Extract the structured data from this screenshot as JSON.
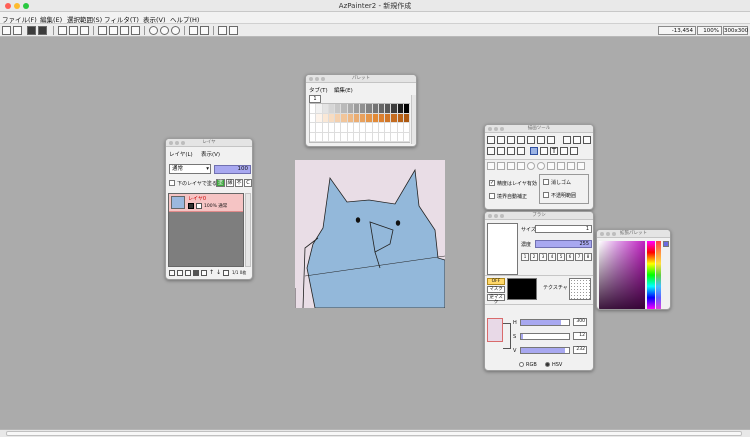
{
  "window": {
    "title": "AzPainter2 - 新規作成"
  },
  "menu": [
    "ファイル(F)",
    "編集(E)",
    "選択範囲(S)",
    "フィルタ(T)",
    "表示(V)",
    "ヘルプ(H)"
  ],
  "status": {
    "coords": "-13,454",
    "zoom": "100%",
    "size": "300x300"
  },
  "palette_panel": {
    "title": "パレット",
    "menu": [
      "タブ(T)",
      "編集(E)"
    ],
    "tab_label": "1",
    "swatches": [
      "#ffffff",
      "#f2f2f2",
      "#e4e4e4",
      "#d6d6d6",
      "#c8c8c8",
      "#bababa",
      "#acacac",
      "#9e9e9e",
      "#909090",
      "#828282",
      "#747474",
      "#666666",
      "#585858",
      "#3c3c3c",
      "#1e1e1e",
      "#000000",
      "#ffffff",
      "#fdf3ea",
      "#fae8d6",
      "#f7dcc2",
      "#f4d0ae",
      "#f1c59a",
      "#eeb986",
      "#ebad72",
      "#e8a15e",
      "#e5964a",
      "#e28a36",
      "#dc8030",
      "#d07628",
      "#c46c20",
      "#b86218",
      "#ac5810",
      "#ffffff",
      "#ffffff",
      "#ffffff",
      "#ffffff",
      "#ffffff",
      "#ffffff",
      "#ffffff",
      "#ffffff",
      "#ffffff",
      "#ffffff",
      "#ffffff",
      "#ffffff",
      "#ffffff",
      "#ffffff",
      "#ffffff",
      "#ffffff",
      "#ffffff",
      "#ffffff",
      "#ffffff",
      "#ffffff",
      "#ffffff",
      "#ffffff",
      "#ffffff",
      "#ffffff",
      "#ffffff",
      "#ffffff",
      "#ffffff",
      "#ffffff",
      "#ffffff",
      "#ffffff",
      "#ffffff",
      "#ffffff"
    ]
  },
  "layer_panel": {
    "title": "レイヤ",
    "menu": [
      "レイヤ(L)",
      "表示(V)"
    ],
    "blend_mode": "通常",
    "opacity": "100",
    "check_label": "下のレイヤで塗る",
    "buttons": [
      "塗",
      "縁",
      "不",
      "C"
    ],
    "layer_name": "レイヤ0",
    "layer_info": "100% 通常",
    "footer_info": "1/1 0枚"
  },
  "tool_panel": {
    "title": "描画ツール",
    "options": [
      "精度はレイヤ有効",
      "境界自動補正",
      "消しゴム",
      "不透明範囲"
    ]
  },
  "option_panel": {
    "title": "ブラシ",
    "size_label": "サイズ",
    "size_value": "1",
    "density_label": "濃度",
    "density_value": "255",
    "presets": [
      "1",
      "2",
      "3",
      "4",
      "5",
      "6",
      "7",
      "8"
    ],
    "mask_off": "OFF",
    "mask_label": "マスク",
    "reverse_mask": "逆マスク",
    "texture_label": "テクスチャ",
    "hue_label": "H",
    "sat_label": "S",
    "val_label": "V",
    "h_value": "300",
    "s_value": "12",
    "v_value": "232",
    "h_level": 0.83,
    "s_level": 0.05,
    "v_level": 0.91,
    "rgb_label": "RGB",
    "hsv_label": "HSV"
  },
  "color_panel": {
    "title": "拡張パレット"
  },
  "colors": {
    "accent_bar": "#a8a8f0",
    "character": "#93b8da",
    "canvas_bg": "#e9dde6"
  }
}
